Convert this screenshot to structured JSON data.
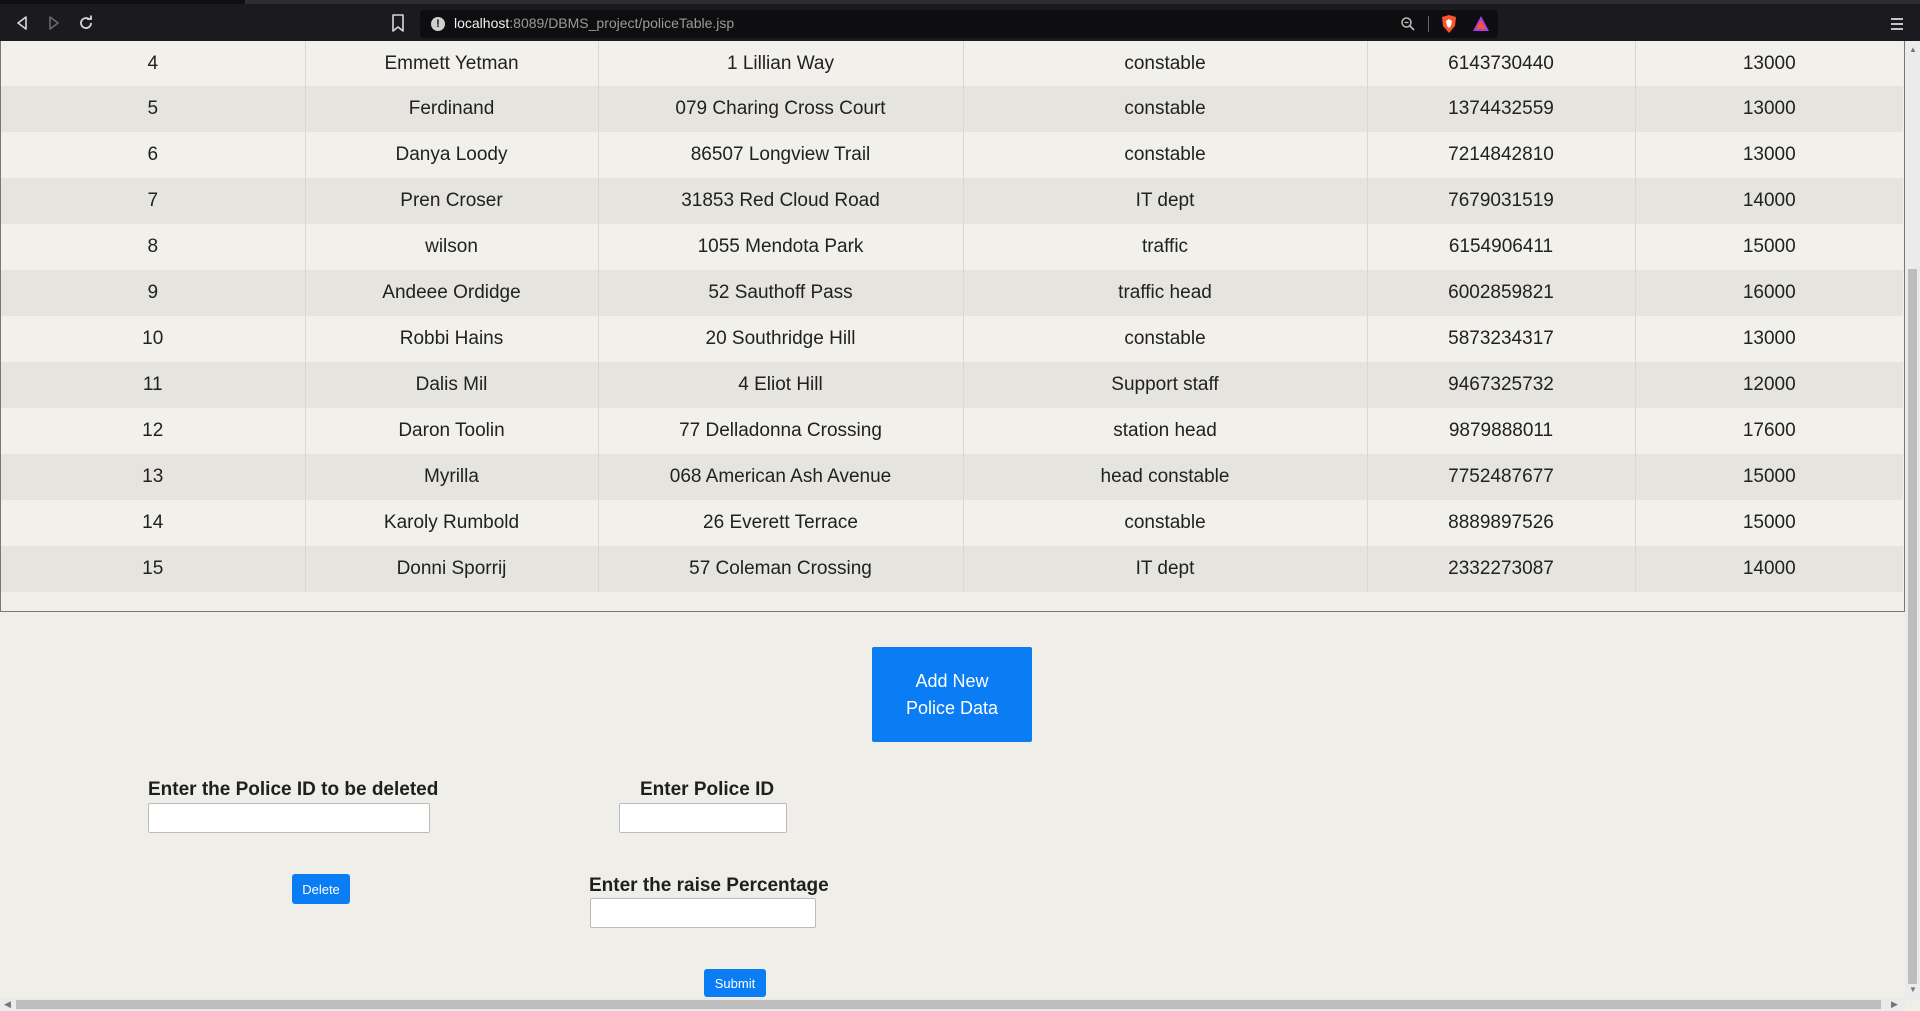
{
  "browser": {
    "url_host": "localhost",
    "url_path": ":8089/DBMS_project/policeTable.jsp"
  },
  "table": {
    "rows": [
      {
        "id": "4",
        "name": "Emmett Yetman",
        "address": "1 Lillian Way",
        "designation": "constable",
        "phone": "6143730440",
        "salary": "13000"
      },
      {
        "id": "5",
        "name": "Ferdinand",
        "address": "079 Charing Cross Court",
        "designation": "constable",
        "phone": "1374432559",
        "salary": "13000"
      },
      {
        "id": "6",
        "name": "Danya Loody",
        "address": "86507 Longview Trail",
        "designation": "constable",
        "phone": "7214842810",
        "salary": "13000"
      },
      {
        "id": "7",
        "name": "Pren Croser",
        "address": "31853 Red Cloud Road",
        "designation": "IT dept",
        "phone": "7679031519",
        "salary": "14000"
      },
      {
        "id": "8",
        "name": "wilson",
        "address": "1055 Mendota Park",
        "designation": "traffic",
        "phone": "6154906411",
        "salary": "15000"
      },
      {
        "id": "9",
        "name": "Andeee Ordidge",
        "address": "52 Sauthoff Pass",
        "designation": "traffic head",
        "phone": "6002859821",
        "salary": "16000"
      },
      {
        "id": "10",
        "name": "Robbi Hains",
        "address": "20 Southridge Hill",
        "designation": "constable",
        "phone": "5873234317",
        "salary": "13000"
      },
      {
        "id": "11",
        "name": "Dalis Mil",
        "address": "4 Eliot Hill",
        "designation": "Support staff",
        "phone": "9467325732",
        "salary": "12000"
      },
      {
        "id": "12",
        "name": "Daron Toolin",
        "address": "77 Delladonna Crossing",
        "designation": "station head",
        "phone": "9879888011",
        "salary": "17600"
      },
      {
        "id": "13",
        "name": "Myrilla",
        "address": "068 American Ash Avenue",
        "designation": "head constable",
        "phone": "7752487677",
        "salary": "15000"
      },
      {
        "id": "14",
        "name": "Karoly Rumbold",
        "address": "26 Everett Terrace",
        "designation": "constable",
        "phone": "8889897526",
        "salary": "15000"
      },
      {
        "id": "15",
        "name": "Donni Sporrij",
        "address": "57 Coleman Crossing",
        "designation": "IT dept",
        "phone": "2332273087",
        "salary": "14000"
      }
    ]
  },
  "add_button": {
    "label_line1": "Add New",
    "label_line2": "Police Data"
  },
  "delete_form": {
    "label": "Enter the Police ID to be deleted",
    "value": "",
    "button_label": "Delete"
  },
  "raise_form": {
    "id_label": "Enter Police ID",
    "id_value": "",
    "percent_label": "Enter the raise Percentage",
    "percent_value": "",
    "button_label": "Submit"
  },
  "colors": {
    "accent": "#0a7cf4",
    "row_odd": "#f1f0eb",
    "row_even": "#e5e4df",
    "chrome": "#1b1b1f"
  },
  "icons": [
    "back-icon",
    "forward-icon",
    "reload-icon",
    "bookmark-icon",
    "site-info-icon",
    "zoom-icon",
    "brave-shield-icon",
    "brave-rewards-icon",
    "menu-icon"
  ]
}
